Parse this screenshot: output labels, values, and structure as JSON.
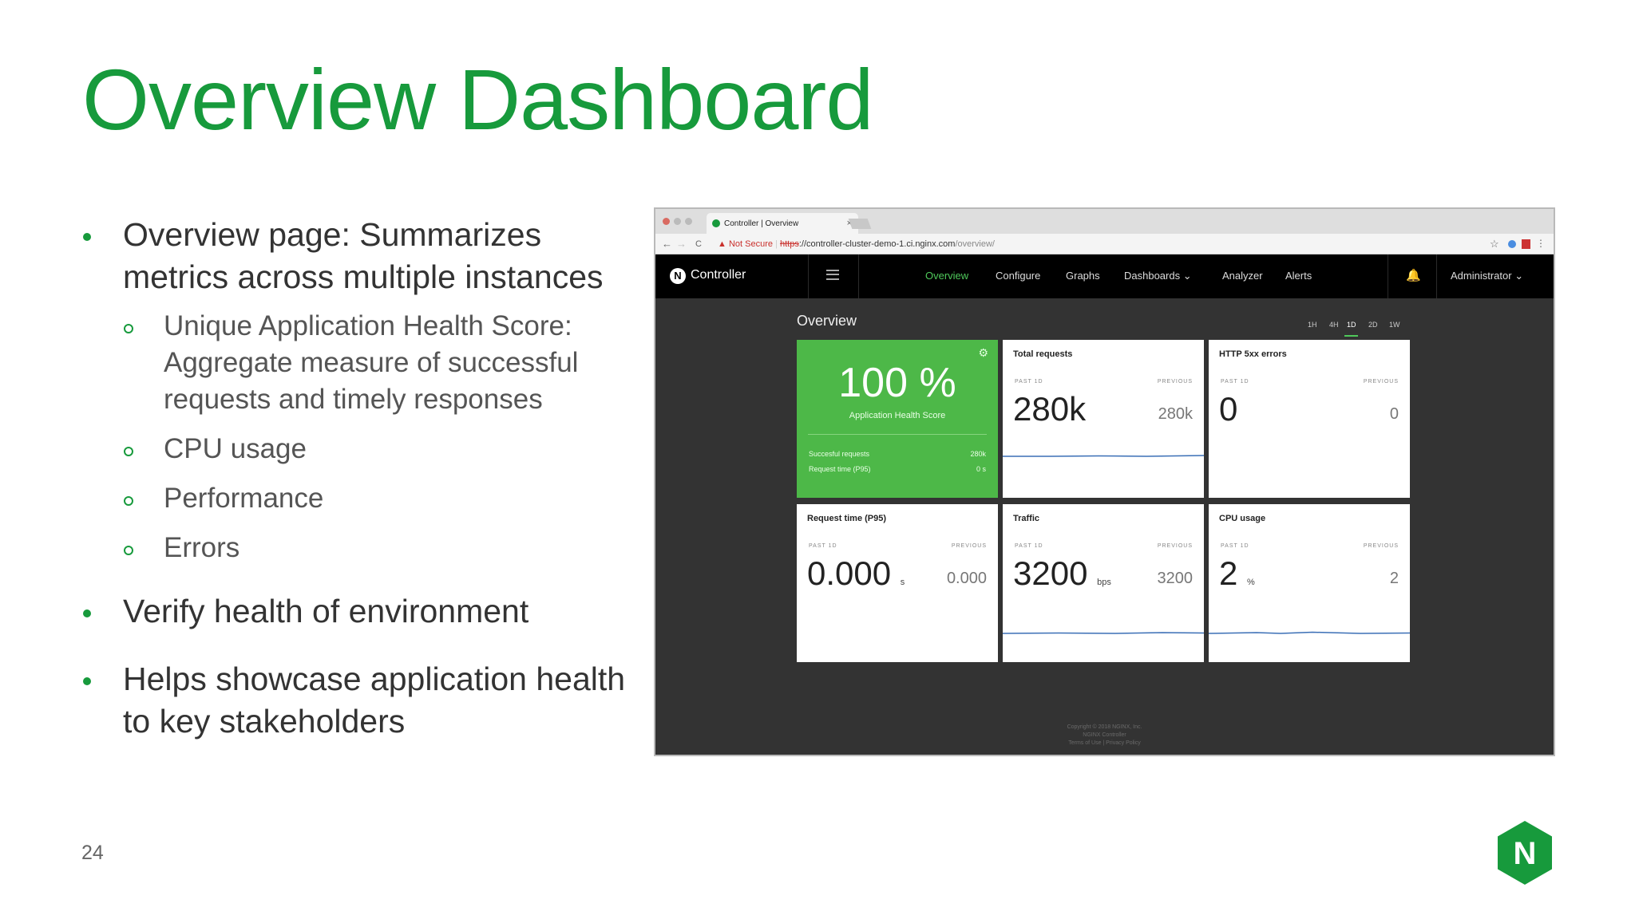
{
  "slide": {
    "title": "Overview Dashboard",
    "page_number": "24",
    "bullets": [
      {
        "lines": [
          "Overview page: Summarizes",
          "metrics across multiple instances"
        ]
      },
      {
        "sub": [
          "Unique Application Health Score:",
          "Aggregate measure of successful",
          "requests and timely responses"
        ]
      },
      {
        "sub": [
          "CPU usage"
        ]
      },
      {
        "sub": [
          "Performance"
        ]
      },
      {
        "sub": [
          "Errors"
        ]
      },
      {
        "lines": [
          "Verify health of environment"
        ]
      },
      {
        "lines": [
          "Helps showcase application health",
          "to key stakeholders"
        ]
      }
    ],
    "logo_letter": "N",
    "brand_color": "#179a3c"
  },
  "browser": {
    "tab_title": "Controller | Overview",
    "tab_close": "×",
    "not_secure": "Not Secure",
    "url_scheme": "https",
    "url_host": "://controller-cluster-demo-1.ci.nginx.com",
    "url_path": "/overview/",
    "back_glyph": "←",
    "forward_glyph": "→",
    "reload_glyph": "C",
    "star_glyph": "☆"
  },
  "app": {
    "brand": "Controller",
    "brand_letter": "N",
    "nav": [
      "Overview",
      "Configure",
      "Graphs",
      "Dashboards ⌄",
      "Analyzer",
      "Alerts"
    ],
    "active_nav": "Overview",
    "bell_glyph": "🔔",
    "user": "Administrator ⌄",
    "page_title": "Overview",
    "time_ranges": [
      "1H",
      "4H",
      "1D",
      "2D",
      "1W"
    ],
    "selected_range": "1D",
    "health": {
      "score": "100 %",
      "label": "Application Health Score",
      "gear_glyph": "⚙",
      "rows": [
        {
          "label": "Succesful requests",
          "value": "280k"
        },
        {
          "label": "Request time (P95)",
          "value": "0 s"
        }
      ]
    },
    "cards": [
      {
        "title": "Total requests",
        "past_label": "PAST 1D",
        "prev_label": "PREVIOUS",
        "value": "280k",
        "unit": "",
        "previous": "280k",
        "sparkline": true
      },
      {
        "title": "HTTP 5xx errors",
        "past_label": "PAST 1D",
        "prev_label": "PREVIOUS",
        "value": "0",
        "unit": "",
        "previous": "0",
        "sparkline": false
      },
      {
        "title": "Request time (P95)",
        "past_label": "PAST 1D",
        "prev_label": "PREVIOUS",
        "value": "0.000",
        "unit": "s",
        "previous": "0.000",
        "sparkline": false
      },
      {
        "title": "Traffic",
        "past_label": "PAST 1D",
        "prev_label": "PREVIOUS",
        "value": "3200",
        "unit": "bps",
        "previous": "3200",
        "sparkline": true
      },
      {
        "title": "CPU usage",
        "past_label": "PAST 1D",
        "prev_label": "PREVIOUS",
        "value": "2",
        "unit": "%",
        "previous": "2",
        "sparkline": true
      }
    ],
    "footer": [
      "Copyright © 2018 NGINX, Inc.",
      "NGINX Controller",
      "Terms of Use  |  Privacy Policy"
    ],
    "colors": {
      "accent": "#4fc95b",
      "health_bg": "#4db848",
      "sparkline": "#3b6fb6",
      "page_bg": "#333333"
    }
  }
}
